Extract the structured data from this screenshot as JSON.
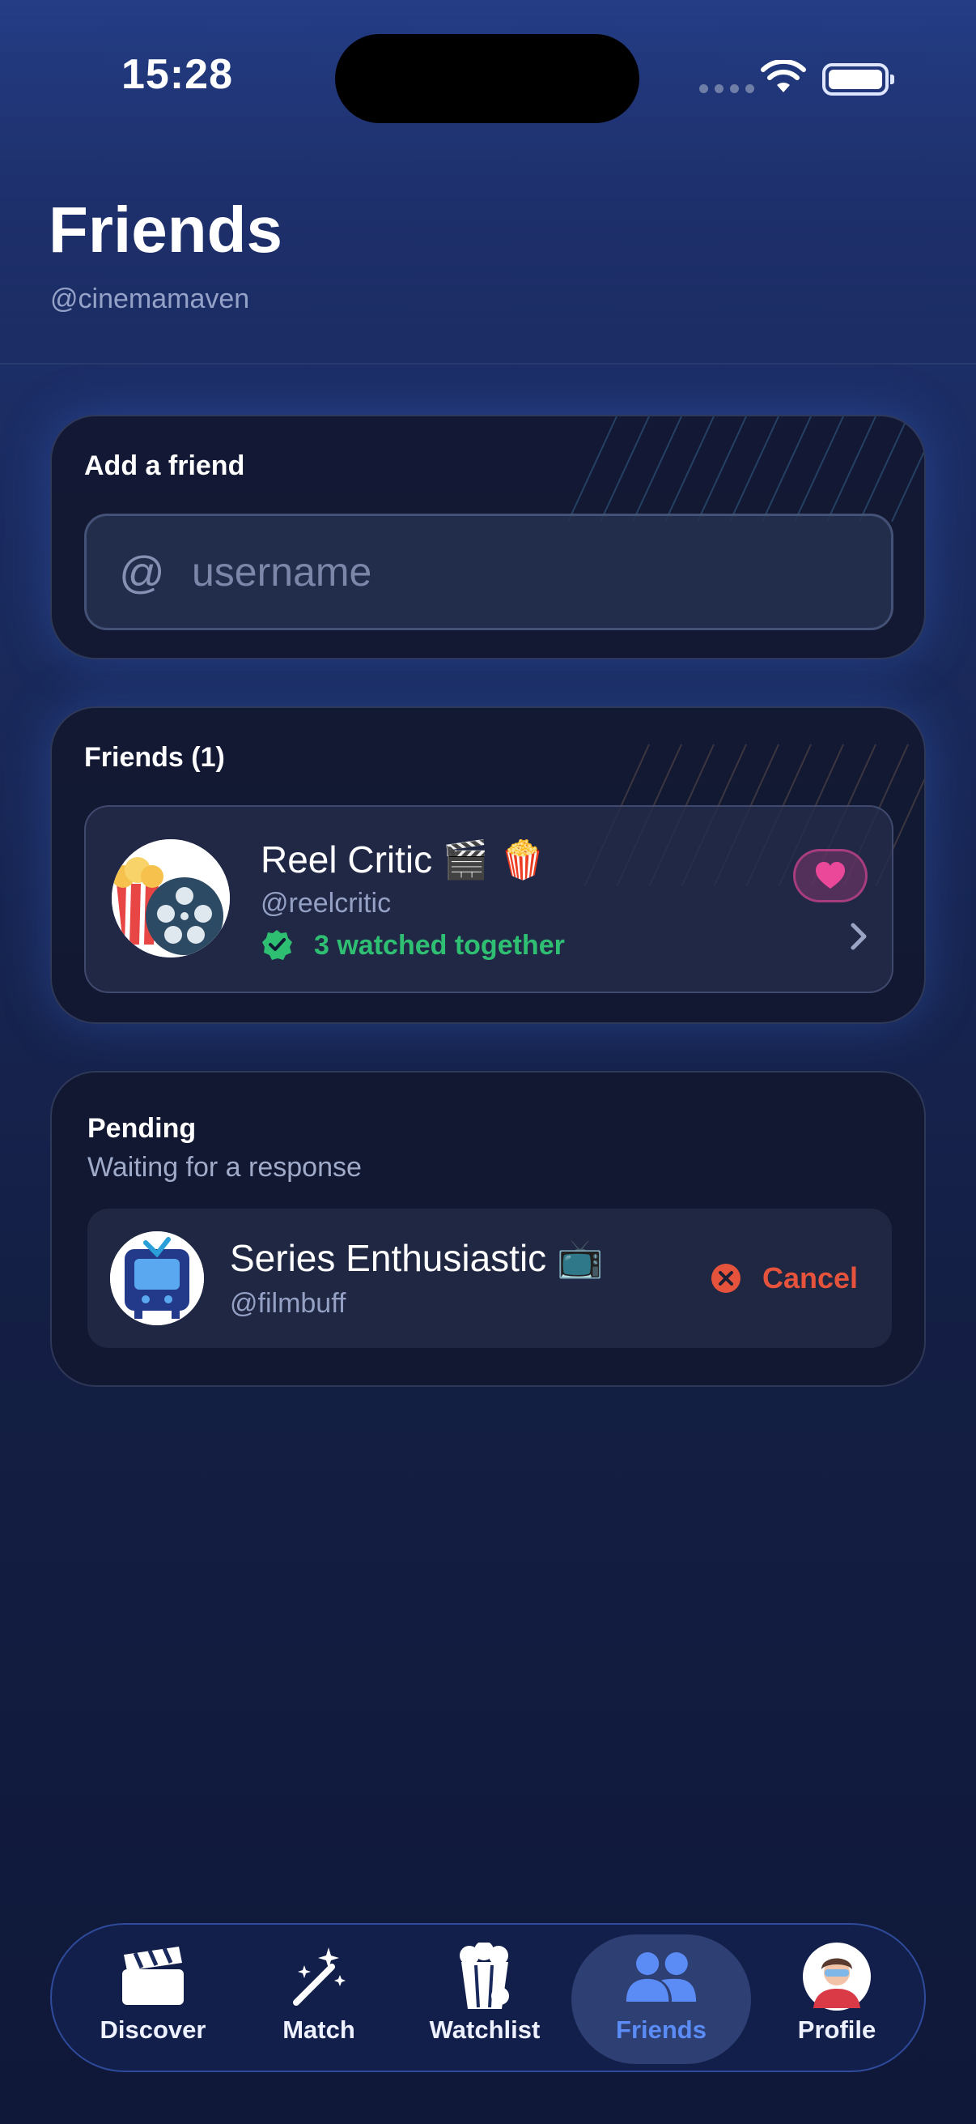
{
  "status_bar": {
    "time": "15:28"
  },
  "header": {
    "title": "Friends",
    "subtitle": "@cinemamaven"
  },
  "add_friend": {
    "label": "Add a friend",
    "at_symbol": "@",
    "placeholder": "username",
    "value": ""
  },
  "friends": {
    "label": "Friends (1)",
    "items": [
      {
        "name": "Reel Critic 🎬 🍿",
        "handle": "@reelcritic",
        "watched_together": "3 watched together"
      }
    ]
  },
  "pending": {
    "title": "Pending",
    "subtitle": "Waiting for a response",
    "items": [
      {
        "name": "Series Enthusiastic 📺",
        "handle": "@filmbuff",
        "cancel_label": "Cancel"
      }
    ]
  },
  "tab_bar": {
    "tabs": [
      {
        "label": "Discover",
        "icon": "clapperboard-icon"
      },
      {
        "label": "Match",
        "icon": "magic-wand-icon"
      },
      {
        "label": "Watchlist",
        "icon": "popcorn-icon"
      },
      {
        "label": "Friends",
        "icon": "people-icon",
        "active": true
      },
      {
        "label": "Profile",
        "icon": "avatar-icon"
      }
    ]
  },
  "colors": {
    "accent": "#5b8cf5",
    "success": "#2fbf72",
    "danger": "#e5533d",
    "heart": "#ec4899"
  }
}
